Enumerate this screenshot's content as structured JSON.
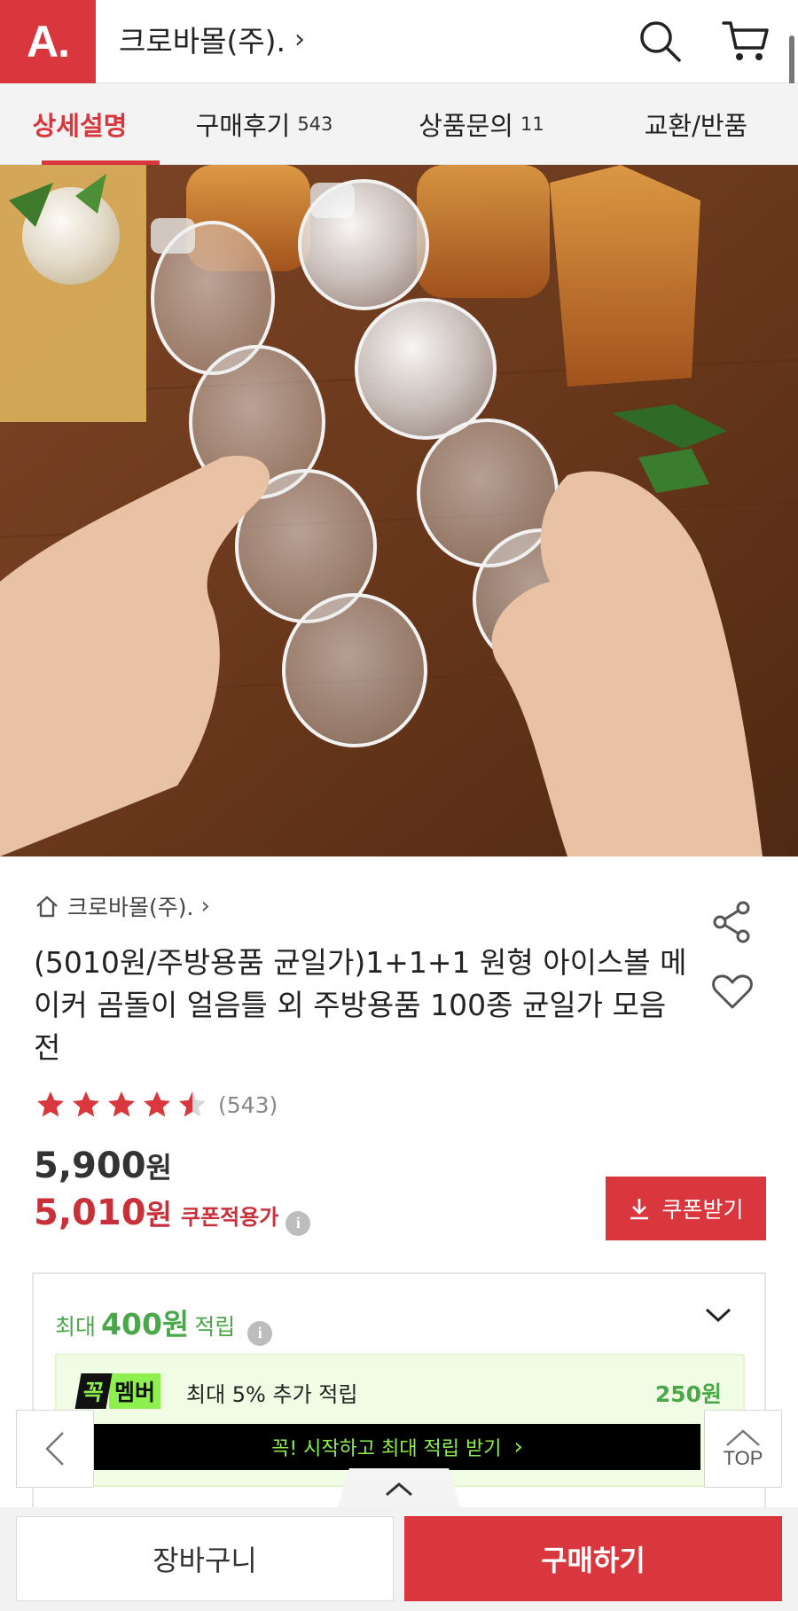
{
  "header": {
    "logo_text": "A.",
    "store_name": "크로바몰(주).",
    "chevron": "›",
    "icons": [
      "search-icon",
      "cart-icon"
    ]
  },
  "tabs": [
    {
      "label": "상세설명",
      "count": "",
      "active": true
    },
    {
      "label": "구매후기",
      "count": "543",
      "active": false
    },
    {
      "label": "상품문의",
      "count": "11",
      "active": false
    },
    {
      "label": "교환/반품",
      "count": "",
      "active": false
    }
  ],
  "product": {
    "store_link": "크로바몰(주).",
    "title": "(5010원/주방용품 균일가)1+1+1 원형 아이스볼 메이커 곰돌이 얼음틀 외 주방용품 100종 균일가 모음전",
    "rating": 4.5,
    "review_count": "(543)",
    "original_price": "5,900",
    "sale_price": "5,010",
    "currency": "원",
    "coupon_price_label": "쿠폰적용가",
    "coupon_button": "쿠폰받기"
  },
  "points": {
    "prefix": "최대",
    "amount": "400원",
    "suffix": "적립",
    "member_badge_1": "꼭",
    "member_badge_2": "멤버",
    "member_text": "최대 5% 추가 적립",
    "member_amount": "250원",
    "member_cta": "꼭! 시작하고 최대 적립 받기",
    "member_cta_chevron": "›"
  },
  "floating": {
    "top_label": "TOP"
  },
  "bottom": {
    "cart_label": "장바구니",
    "buy_label": "구매하기"
  },
  "colors": {
    "brand_red": "#d9373d",
    "price_red": "#c9303a",
    "points_green": "#4aa84a",
    "member_green": "#8ef04e"
  }
}
